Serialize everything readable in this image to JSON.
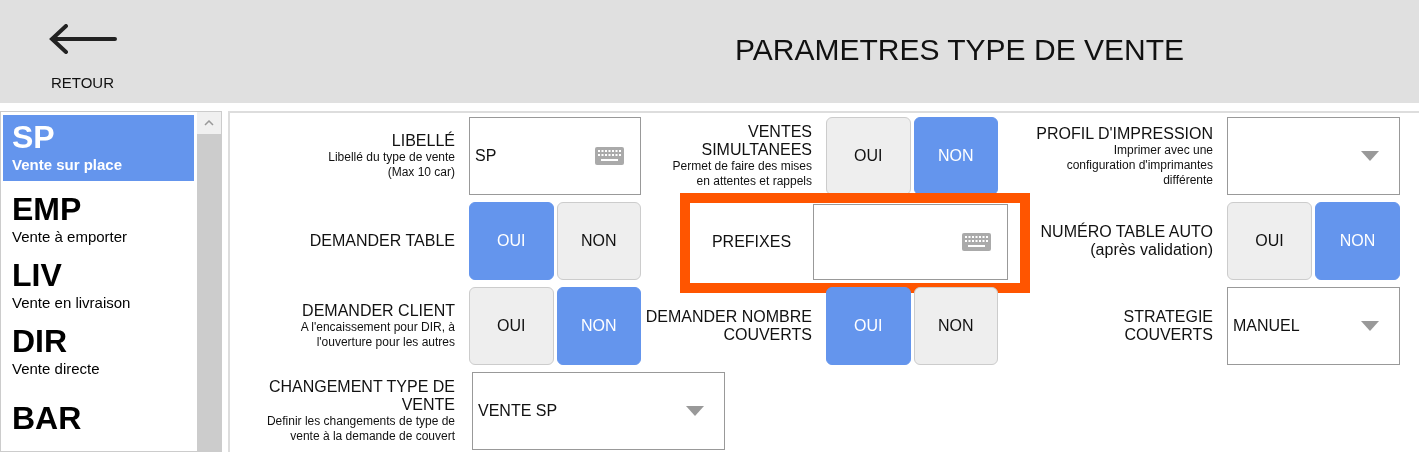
{
  "header": {
    "back_label": "RETOUR",
    "title": "PARAMETRES TYPE DE VENTE"
  },
  "sidebar": {
    "items": [
      {
        "code": "SP",
        "name": "Vente sur place",
        "selected": true
      },
      {
        "code": "EMP",
        "name": "Vente à emporter",
        "selected": false
      },
      {
        "code": "LIV",
        "name": "Vente en livraison",
        "selected": false
      },
      {
        "code": "DIR",
        "name": "Vente directe",
        "selected": false
      },
      {
        "code": "BAR",
        "selected": false
      }
    ]
  },
  "settings": [
    {
      "kind": "text",
      "label": "LIBELLÉ",
      "description": "Libellé du type de vente\n(Max 10 car)",
      "value": "SP"
    },
    {
      "kind": "toggle",
      "label": "VENTES\nSIMULTANEES",
      "description": "Permet de faire des mises\nen attentes et rappels",
      "options": [
        {
          "label": "OUI",
          "selected": false
        },
        {
          "label": "NON",
          "selected": true
        }
      ]
    },
    {
      "kind": "select",
      "label": "PROFIL D'IMPRESSION",
      "description": "Imprimer avec une\nconfiguration d'imprimantes\ndifférente"
    },
    {
      "kind": "toggle",
      "label": "DEMANDER TABLE",
      "options": [
        {
          "label": "OUI",
          "selected": true
        },
        {
          "label": "NON",
          "selected": false
        }
      ]
    },
    {
      "kind": "text",
      "label": "PREFIXES",
      "highlighted": true
    },
    {
      "kind": "toggle",
      "label": "NUMÉRO TABLE AUTO\n(après validation)",
      "options": [
        {
          "label": "OUI",
          "selected": false
        },
        {
          "label": "NON",
          "selected": true
        }
      ]
    },
    {
      "kind": "toggle",
      "label": "DEMANDER CLIENT",
      "description": "A l'encaissement pour DIR, à\nl'ouverture pour les autres",
      "options": [
        {
          "label": "OUI",
          "selected": false
        },
        {
          "label": "NON",
          "selected": true
        }
      ]
    },
    {
      "kind": "toggle",
      "label": "DEMANDER NOMBRE\nCOUVERTS",
      "options": [
        {
          "label": "OUI",
          "selected": true
        },
        {
          "label": "NON",
          "selected": false
        }
      ]
    },
    {
      "kind": "select",
      "label": "STRATEGIE\nCOUVERTS",
      "value": "MANUEL"
    },
    {
      "kind": "select",
      "label": "CHANGEMENT TYPE DE\nVENTE",
      "description": "Definir les changements de type de\nvente à la demande de couvert",
      "value": "VENTE SP"
    }
  ]
}
